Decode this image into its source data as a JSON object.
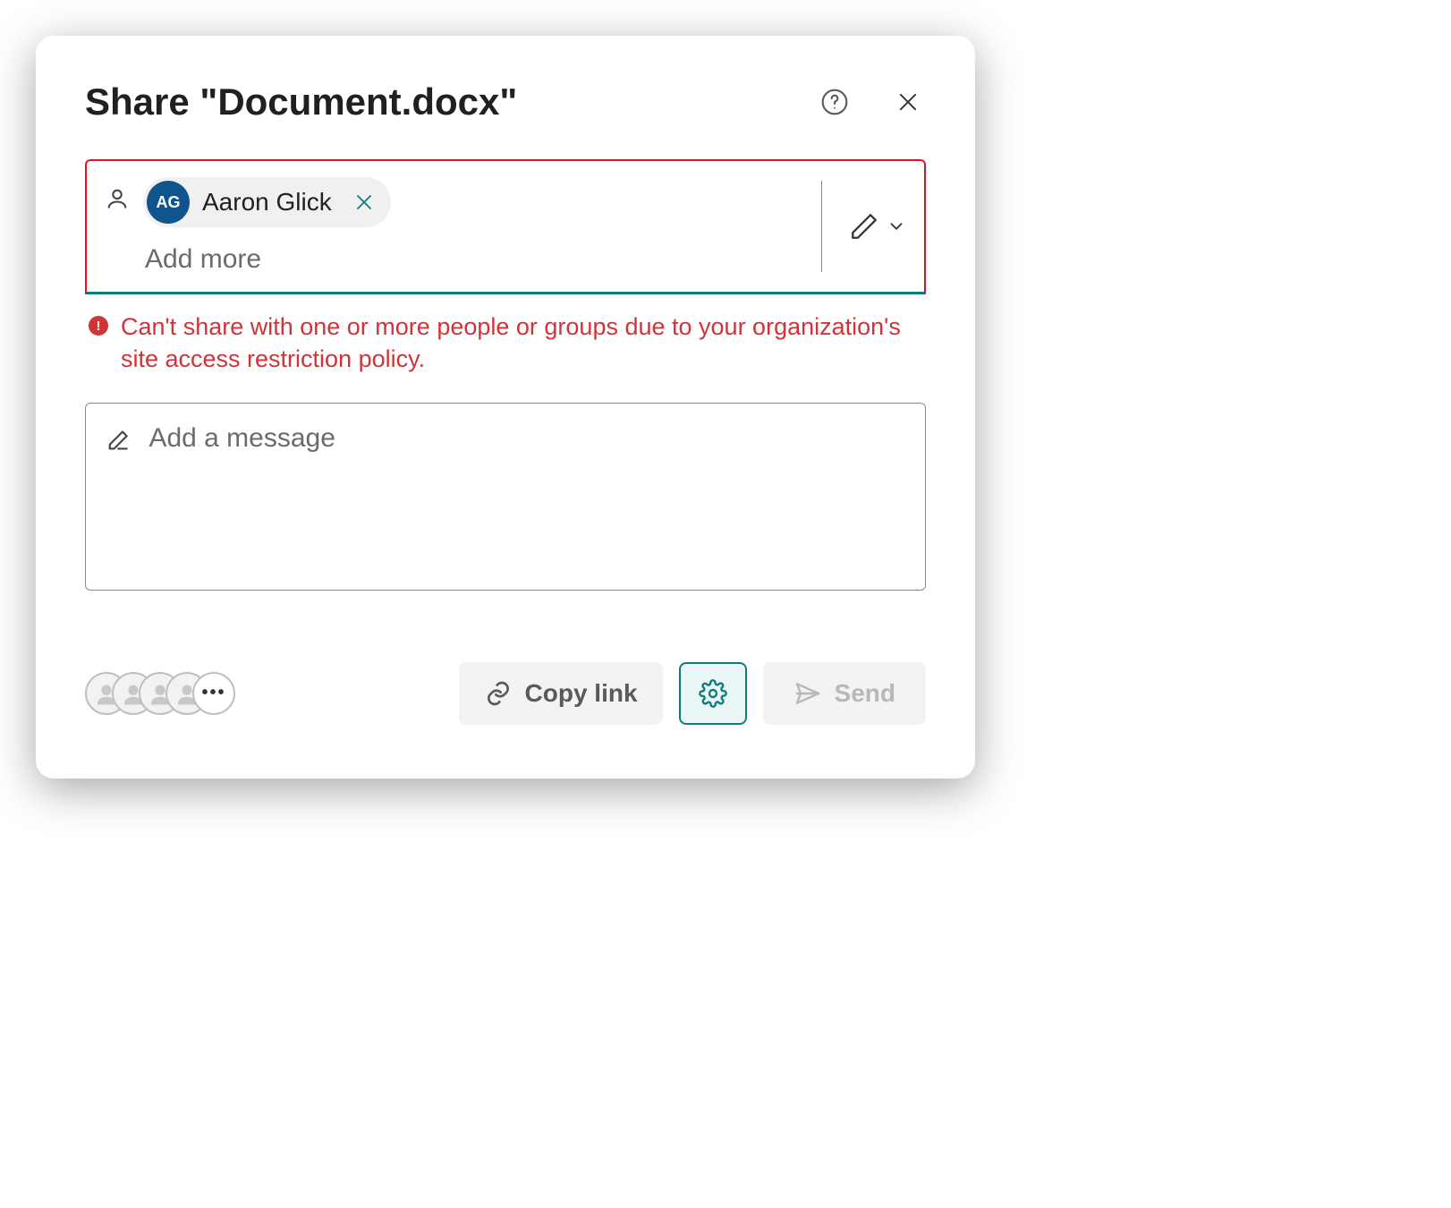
{
  "dialog": {
    "title": "Share \"Document.docx\""
  },
  "recipients": {
    "chip": {
      "initials": "AG",
      "name": "Aaron Glick"
    },
    "add_more_placeholder": "Add more"
  },
  "error": {
    "message": "Can't share with one or more people or groups due to your organization's site access restriction policy."
  },
  "message_box": {
    "placeholder": "Add a message"
  },
  "footer": {
    "copy_link_label": "Copy link",
    "send_label": "Send",
    "more_label": "•••"
  }
}
